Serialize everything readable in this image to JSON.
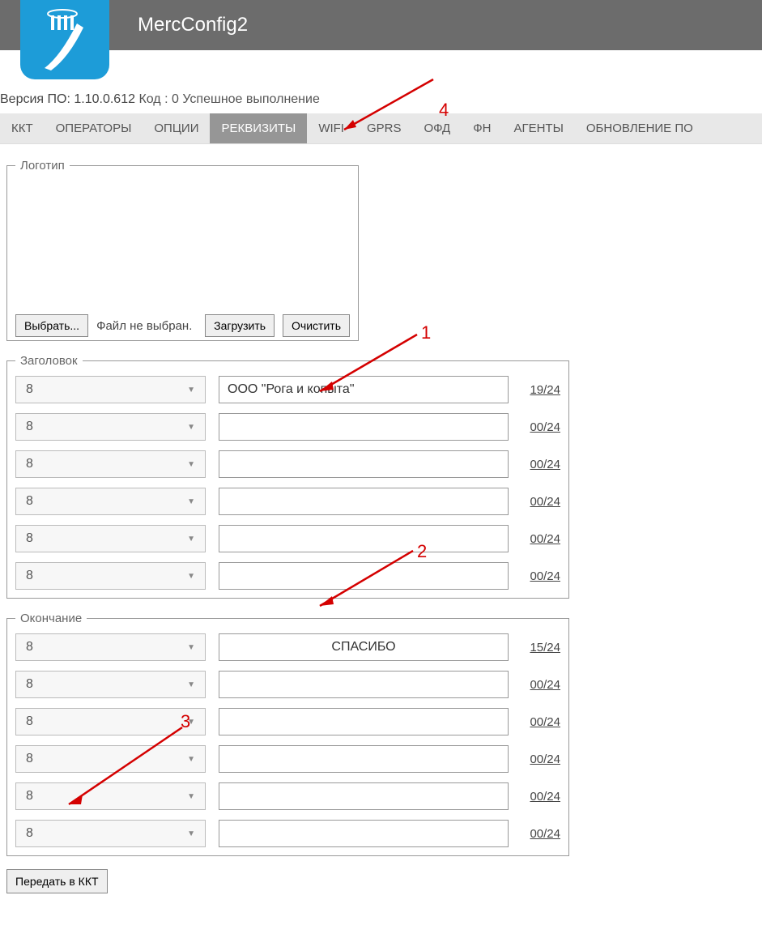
{
  "header": {
    "title": "MercConfig2"
  },
  "status": {
    "versionLabel": "Версия ПО:",
    "version": "1.10.0.612",
    "codeLabel": "Код : 0 Успешное выполнение"
  },
  "tabs": {
    "items": [
      "ККТ",
      "ОПЕРАТОРЫ",
      "ОПЦИИ",
      "РЕКВИЗИТЫ",
      "WIFI",
      "GPRS",
      "ОФД",
      "ФН",
      "АГЕНТЫ",
      "ОБНОВЛЕНИЕ ПО"
    ],
    "activeIndex": 3
  },
  "logoSection": {
    "legend": "Логотип",
    "chooseBtn": "Выбрать...",
    "fileStatus": "Файл не выбран.",
    "uploadBtn": "Загрузить",
    "clearBtn": "Очистить"
  },
  "headerSection": {
    "legend": "Заголовок",
    "rows": [
      {
        "size": "8",
        "text": "ООО \"Рога и копыта\"",
        "counter": "19/24"
      },
      {
        "size": "8",
        "text": "",
        "counter": "00/24"
      },
      {
        "size": "8",
        "text": "",
        "counter": "00/24"
      },
      {
        "size": "8",
        "text": "",
        "counter": "00/24"
      },
      {
        "size": "8",
        "text": "",
        "counter": "00/24"
      },
      {
        "size": "8",
        "text": "",
        "counter": "00/24"
      }
    ]
  },
  "footerSection": {
    "legend": "Окончание",
    "rows": [
      {
        "size": "8",
        "text": "СПАСИБО",
        "counter": "15/24"
      },
      {
        "size": "8",
        "text": "",
        "counter": "00/24"
      },
      {
        "size": "8",
        "text": "",
        "counter": "00/24"
      },
      {
        "size": "8",
        "text": "",
        "counter": "00/24"
      },
      {
        "size": "8",
        "text": "",
        "counter": "00/24"
      },
      {
        "size": "8",
        "text": "",
        "counter": "00/24"
      }
    ]
  },
  "submit": {
    "label": "Передать в ККТ"
  },
  "annotations": {
    "n1": "1",
    "n2": "2",
    "n3": "3",
    "n4": "4"
  }
}
